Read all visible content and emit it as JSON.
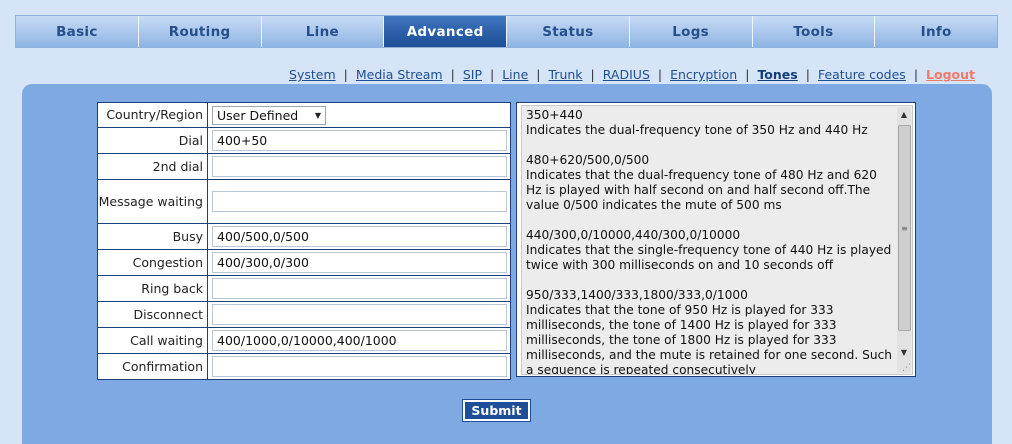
{
  "tabs": [
    "Basic",
    "Routing",
    "Line",
    "Advanced",
    "Status",
    "Logs",
    "Tools",
    "Info"
  ],
  "active_tab": "Advanced",
  "subnav": {
    "items": [
      "System",
      "Media Stream",
      "SIP",
      "Line",
      "Trunk",
      "RADIUS",
      "Encryption",
      "Tones",
      "Feature codes"
    ],
    "current": "Tones",
    "logout": "Logout",
    "separator": "|"
  },
  "form": {
    "country_label": "Country/Region",
    "country_value": "User Defined",
    "rows": [
      {
        "label": "Dial",
        "value": "400+50"
      },
      {
        "label": "2nd dial",
        "value": ""
      },
      {
        "label": "Message waiting",
        "value": ""
      },
      {
        "label": "Busy",
        "value": "400/500,0/500"
      },
      {
        "label": "Congestion",
        "value": "400/300,0/300"
      },
      {
        "label": "Ring back",
        "value": ""
      },
      {
        "label": "Disconnect",
        "value": ""
      },
      {
        "label": "Call waiting",
        "value": "400/1000,0/10000,400/1000"
      },
      {
        "label": "Confirmation",
        "value": ""
      }
    ]
  },
  "help": [
    {
      "title": "350+440",
      "desc": "Indicates the dual-frequency tone of 350 Hz and 440 Hz"
    },
    {
      "title": "480+620/500,0/500",
      "desc": "Indicates that the dual-frequency tone of 480 Hz and 620 Hz is played with half second on and half second off.The value 0/500 indicates the mute of 500 ms"
    },
    {
      "title": "440/300,0/10000,440/300,0/10000",
      "desc": "Indicates that the single-frequency tone of 440 Hz is played twice with 300 milliseconds on and 10 seconds off"
    },
    {
      "title": "950/333,1400/333,1800/333,0/1000",
      "desc": "Indicates that the tone of 950 Hz is played for 333 milliseconds, the tone of 1400 Hz is played for 333 milliseconds, the tone of 1800 Hz is played for 333 milliseconds, and the mute is retained for one second. Such a sequence is repeated consecutively"
    }
  ],
  "submit_label": "Submit",
  "icons": {
    "select_arrow": "dropdown-arrow-icon",
    "scroll_up": "scroll-up-icon",
    "scroll_down": "scroll-down-icon",
    "resize_grip": "resize-grip-icon"
  },
  "colors": {
    "page_bg": "#d6e4f7",
    "panel_bg": "#7fa9e3",
    "tab_active": "#2a5fa8",
    "tab_inactive": "#a9c6ec",
    "link": "#1d4f92",
    "logout": "#f07a6a",
    "submit_bg": "#1e4f96"
  }
}
